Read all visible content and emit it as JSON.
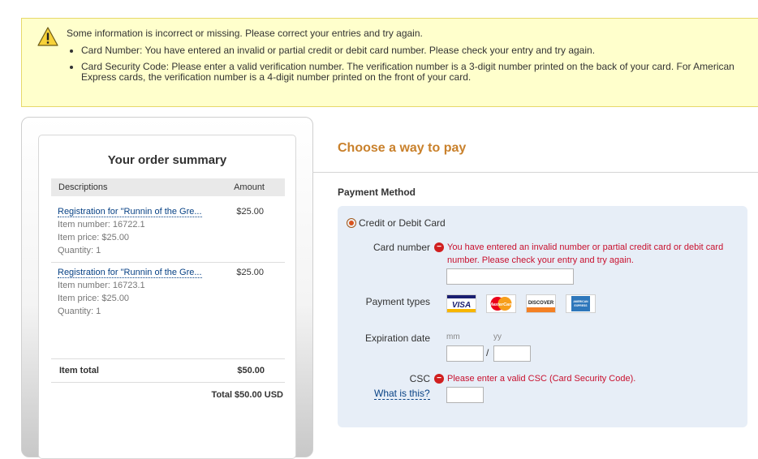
{
  "alert": {
    "intro": "Some information is incorrect or missing. Please correct your entries and try again.",
    "items": [
      "Card Number: You have entered an invalid or partial credit or debit card number. Please check your entry and try again.",
      "Card Security Code: Please enter a valid verification number. The verification number is a 3-digit number printed on the back of your card. For American Express cards, the verification number is a 4-digit number printed on the front of your card."
    ]
  },
  "summary": {
    "title": "Your order summary",
    "col_desc": "Descriptions",
    "col_amount": "Amount",
    "items": [
      {
        "name": "Registration for \"Runnin of the Gre...",
        "amount": "$25.00",
        "item_number": "Item number: 16722.1",
        "item_price": "Item price: $25.00",
        "quantity": "Quantity: 1"
      },
      {
        "name": "Registration for \"Runnin of the Gre...",
        "amount": "$25.00",
        "item_number": "Item number: 16723.1",
        "item_price": "Item price: $25.00",
        "quantity": "Quantity: 1"
      }
    ],
    "item_total_label": "Item total",
    "item_total_value": "$50.00",
    "grand_total": "Total $50.00 USD"
  },
  "payment": {
    "heading": "Choose a way to pay",
    "method_title": "Payment Method",
    "option_label": "Credit or Debit Card",
    "card_number_label": "Card number",
    "card_number_error": "You have entered an invalid number or partial credit card or debit card number. Please check your entry and try again.",
    "card_number_value": "",
    "payment_types_label": "Payment types",
    "card_types": [
      "VISA",
      "MasterCard",
      "DISCOVER",
      "AMERICAN EXPRESS"
    ],
    "expiration_label": "Expiration date",
    "mm_hint": "mm",
    "yy_hint": "yy",
    "slash": "/",
    "mm_value": "",
    "yy_value": "",
    "csc_label": "CSC",
    "csc_error": "Please enter a valid CSC (Card Security Code).",
    "what_is_this": "What is this?",
    "csc_value": ""
  },
  "colors": {
    "alert_bg": "#ffffcc",
    "heading_orange": "#c9812c",
    "error_red": "#c8102e",
    "link_blue": "#084285",
    "panel_bg": "#e7eef7"
  }
}
